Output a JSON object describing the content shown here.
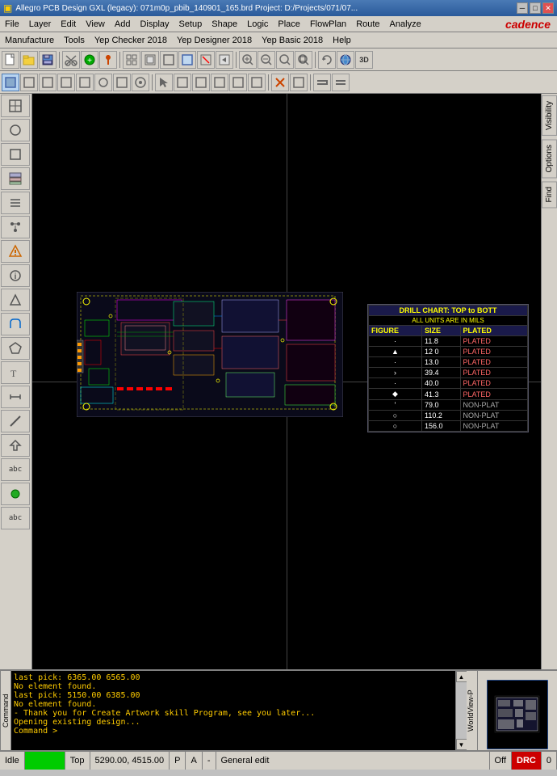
{
  "titlebar": {
    "title": "Allegro PCB Design GXL (legacy): 071m0p_pbib_140901_165.brd  Project: D:/Projects/071/07...",
    "app_icon": "▣",
    "btn_min": "─",
    "btn_max": "□",
    "btn_close": "✕"
  },
  "menubar": {
    "items": [
      "File",
      "Layer",
      "Edit",
      "View",
      "Add",
      "Display",
      "Setup",
      "Shape",
      "Logic",
      "Place",
      "FlowPlan",
      "Route",
      "Analyze",
      "Manufacture",
      "Tools",
      "Yep Checker 2018",
      "Yep Designer 2018",
      "Yep Basic 2018",
      "Help"
    ]
  },
  "toolbar1": {
    "buttons": [
      "📁",
      "📂",
      "💾",
      "✂",
      "⊕",
      "↩",
      "↪",
      "⬇",
      "⬆",
      "●",
      "📌",
      "|",
      "⊞",
      "⊟",
      "🔲",
      "🔳",
      "⊕",
      "✕",
      "🔙",
      "🔀",
      "🔜",
      "🔍+",
      "🔍-",
      "🔍",
      "🔍",
      "↺",
      "🌐",
      "3D"
    ]
  },
  "toolbar2": {
    "buttons": [
      "▦",
      "◻",
      "◻",
      "◻",
      "◻",
      "◻",
      "◻",
      "◻",
      "◻",
      "◻",
      "◻",
      "◻",
      "◻",
      "◻",
      "◻",
      "◻",
      "◻",
      "◻",
      "◻",
      "◻",
      "◻",
      "◻",
      "◻",
      "◻",
      "◻",
      "◻",
      "◻",
      "◻",
      "◻",
      "◻",
      "◻",
      "◻"
    ]
  },
  "left_sidebar": {
    "buttons": [
      "⊞",
      "◻",
      "◻",
      "◻",
      "≡",
      "◻",
      "◻",
      "◻",
      "◻",
      "◻",
      "◻",
      "◻",
      "◻",
      "◻",
      "◻",
      "◻",
      "◻",
      "◻",
      "◻",
      "abc",
      "◻",
      "abc"
    ]
  },
  "right_panel": {
    "tabs": [
      "Visibility",
      "Options",
      "Find"
    ]
  },
  "drill_chart": {
    "title": "DRILL CHART: TOP to BOTT",
    "subtitle": "ALL UNITS ARE IN MILS",
    "headers": [
      "FIGURE",
      "SIZE",
      "PLATED"
    ],
    "rows": [
      [
        "·",
        "11.8",
        "PLATED"
      ],
      [
        "▲",
        "12.0",
        "PLATED"
      ],
      [
        "·",
        "13.0",
        "PLATED"
      ],
      [
        ">",
        "39.4",
        "PLATED"
      ],
      [
        "·",
        "40.0",
        "PLATED"
      ],
      [
        "◆",
        "41.3",
        "PLATED"
      ],
      [
        "'",
        "79.0",
        "NON-PLAT"
      ],
      [
        "○",
        "110.2",
        "NON-PLAT"
      ],
      [
        "○",
        "156.0",
        "NON-PLAT"
      ]
    ]
  },
  "console": {
    "lines": [
      "last pick:  6365.00 6565.00",
      "No element found.",
      "last pick:  5150.00 6385.00",
      "No element found.",
      "- Thank you for Create Artwork skill Program, see you later...",
      "Opening existing design...",
      "Command >"
    ],
    "label": "Command"
  },
  "statusbar": {
    "idle": "Idle",
    "mode_indicator": "",
    "layer": "Top",
    "coordinates": "5290.00, 4515.00",
    "p_indicator": "P",
    "a_indicator": "A",
    "dash": "-",
    "mode": "General edit",
    "off": "Off",
    "drc": "DRC",
    "number": "0"
  }
}
